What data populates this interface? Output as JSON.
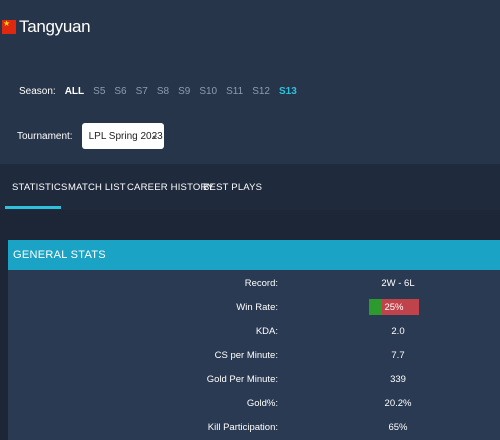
{
  "player": {
    "name": "Tangyuan",
    "flag_icon": "china-flag-icon"
  },
  "season": {
    "label": "Season:",
    "items": [
      "ALL",
      "S5",
      "S6",
      "S7",
      "S8",
      "S9",
      "S10",
      "S11",
      "S12",
      "S13"
    ],
    "bold_item": "ALL",
    "highlighted_item": "S13"
  },
  "tournament": {
    "label": "Tournament:",
    "selected": "LPL Spring 2023"
  },
  "tabs": [
    "STATISTICS",
    "MATCH LIST",
    "CAREER HISTORY",
    "BEST PLAYS"
  ],
  "active_tab": "STATISTICS",
  "general_stats": {
    "title": "GENERAL STATS",
    "rows": [
      {
        "label": "Record:",
        "value": "2W - 6L"
      },
      {
        "label": "Win Rate:",
        "value": "25%",
        "fraction": 0.25
      },
      {
        "label": "KDA:",
        "value": "2.0"
      },
      {
        "label": "CS per Minute:",
        "value": "7.7"
      },
      {
        "label": "Gold Per Minute:",
        "value": "339"
      },
      {
        "label": "Gold%:",
        "value": "20.2%"
      },
      {
        "label": "Kill Participation:",
        "value": "65%"
      }
    ]
  },
  "colors": {
    "accent": "#2fc0dc",
    "stats_header": "#1ba3c6",
    "win": "#2c9a2c",
    "loss": "#c0434c"
  }
}
